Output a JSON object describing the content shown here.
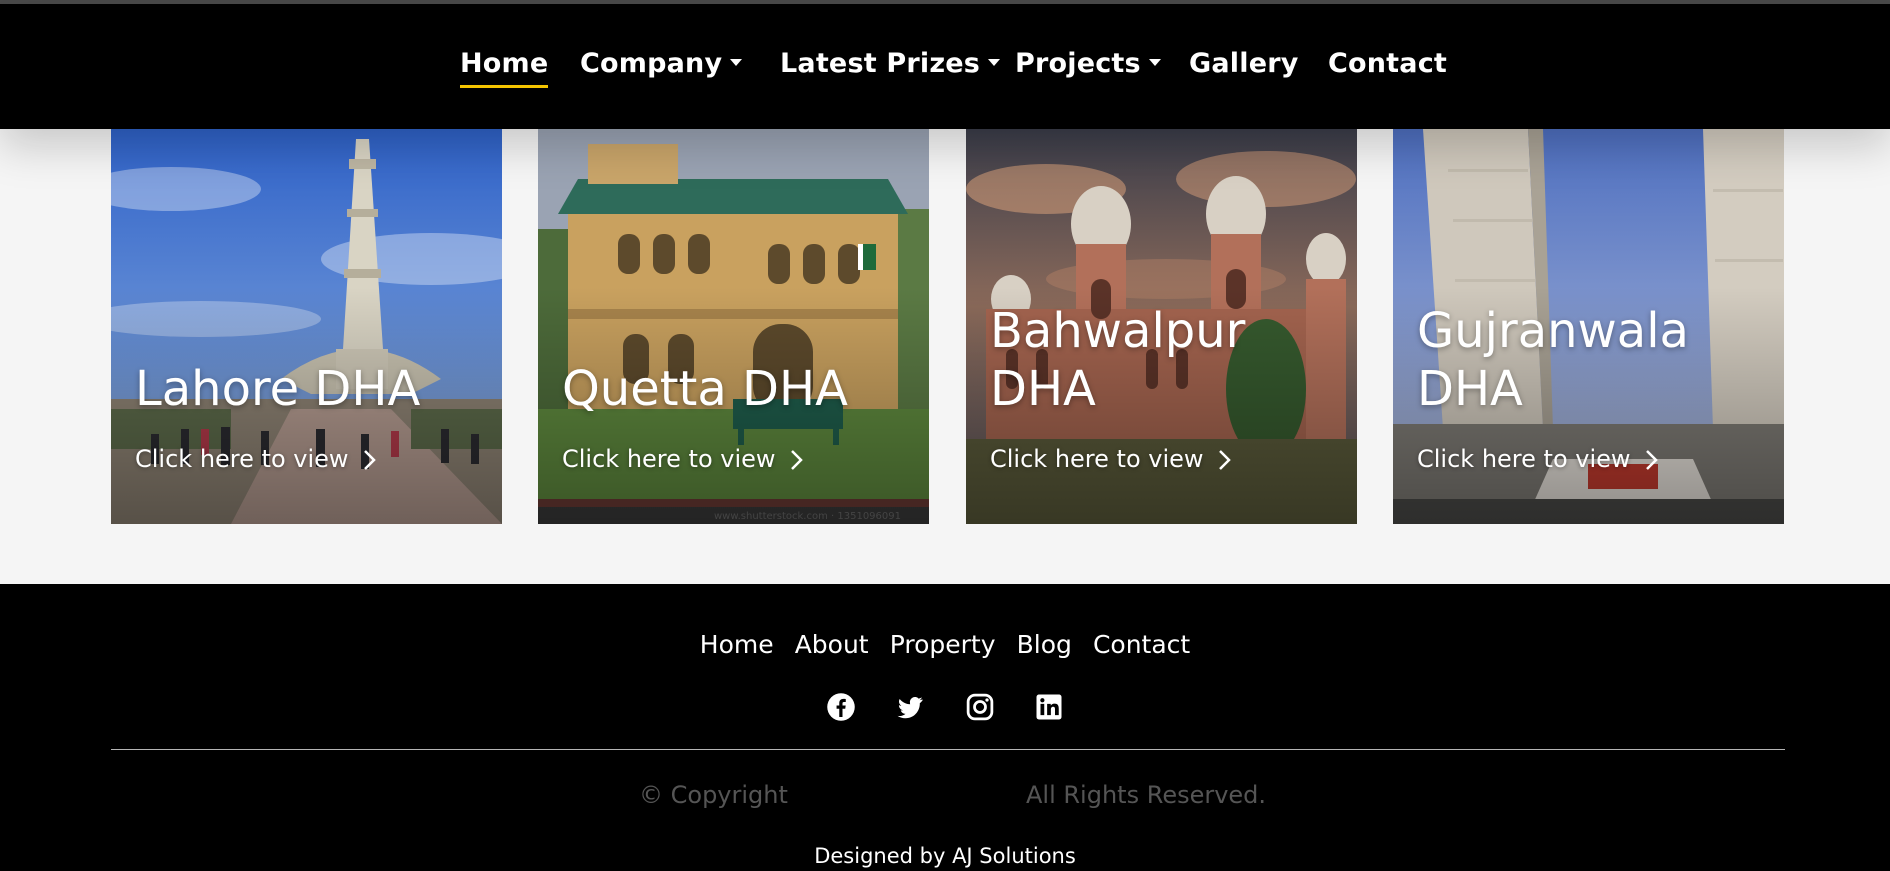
{
  "nav": {
    "items": [
      {
        "label": "Home",
        "active": true,
        "dropdown": false
      },
      {
        "label": "Company",
        "dropdown": true
      },
      {
        "label": "Latest Prizes",
        "dropdown": true
      },
      {
        "label": "Projects",
        "dropdown": true
      },
      {
        "label": "Gallery",
        "dropdown": false
      },
      {
        "label": "Contact",
        "dropdown": false
      }
    ],
    "accent_color": "#f4c400"
  },
  "cards": [
    {
      "title": "Lahore DHA",
      "link_text": "Click here to view"
    },
    {
      "title": "Quetta DHA",
      "link_text": "Click here to view",
      "watermark": "www.shutterstock.com · 1351096091"
    },
    {
      "title": "Bahwalpur DHA",
      "link_text": "Click here to view"
    },
    {
      "title": "Gujranwala DHA",
      "link_text": "Click here to view"
    }
  ],
  "footer": {
    "links": [
      "Home",
      "About",
      "Property",
      "Blog",
      "Contact"
    ],
    "socials": [
      "facebook-icon",
      "twitter-icon",
      "instagram-icon",
      "linkedin-icon"
    ],
    "copyright": "© Copyright",
    "rights": "All Rights Reserved.",
    "designed_by": "Designed by AJ Solutions"
  }
}
